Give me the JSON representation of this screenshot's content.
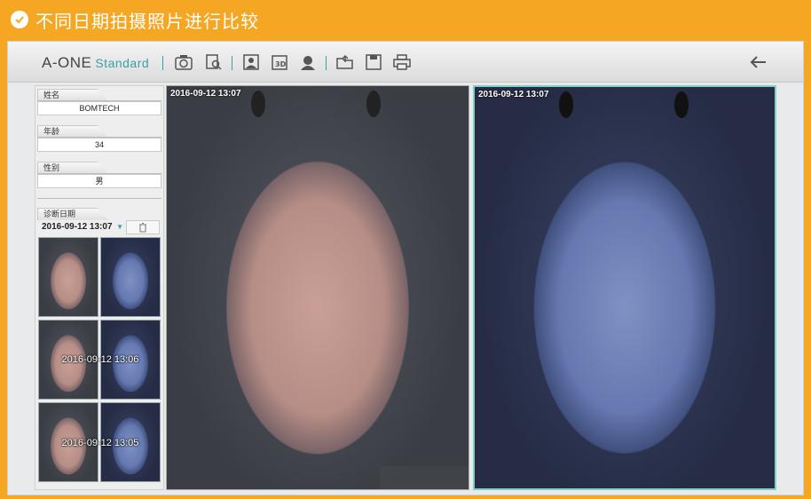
{
  "banner": {
    "title": "不同日期拍摄照片进行比较"
  },
  "app": {
    "logo_main": "A-ONE",
    "logo_edition": "Standard",
    "toolbar_icons": [
      "camera-icon",
      "search-document-icon",
      "portrait-icon",
      "3d-icon",
      "profile-icon",
      "folder-open-icon",
      "save-icon",
      "print-icon"
    ],
    "back_icon": "arrow-left-icon",
    "accent_color": "#3a9fa0"
  },
  "patient": {
    "name_label": "姓名",
    "name_value": "BOMTECH",
    "age_label": "年龄",
    "age_value": "34",
    "gender_label": "性别",
    "gender_value": "男",
    "date_label": "诊断日期",
    "selected_date": "2016-09-12 13:07"
  },
  "thumbnails": {
    "rows": [
      {
        "label": ""
      },
      {
        "label": "2016-09-12 13:06"
      },
      {
        "label": "2016-09-12 13:05"
      }
    ]
  },
  "viewers": {
    "left_date": "2016-09-12 13:07",
    "right_date": "2016-09-12 13:07"
  }
}
